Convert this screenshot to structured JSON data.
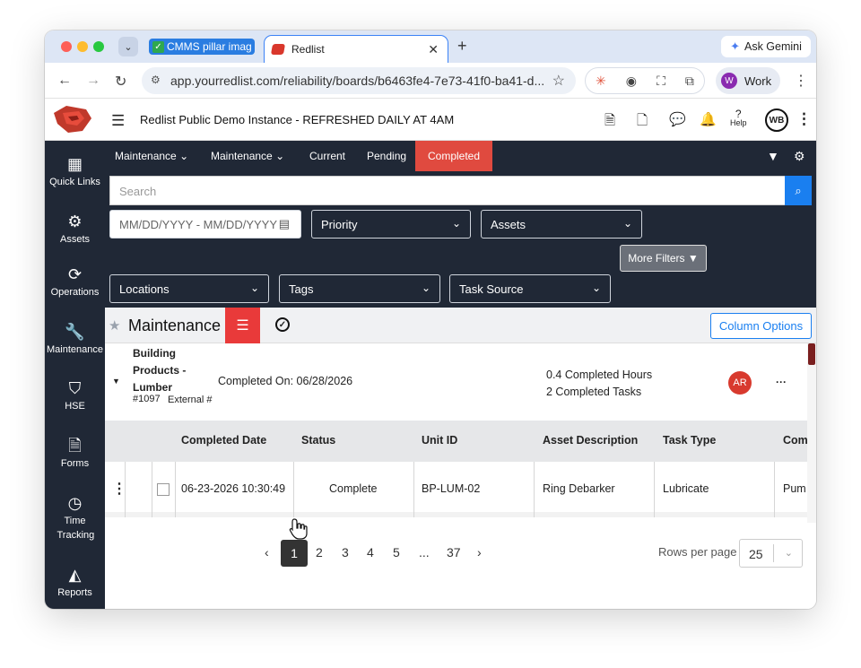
{
  "browser": {
    "tabs": [
      {
        "label": "CMMS pillar imag"
      },
      {
        "label": "Redlist"
      }
    ],
    "ask_gemini": "Ask Gemini",
    "url": "app.yourredlist.com/reliability/boards/b6463fe4-7e73-41f0-ba41-d...",
    "profile": {
      "initial": "W",
      "label": "Work"
    }
  },
  "app_header": {
    "title": "Redlist Public Demo Instance - REFRESHED DAILY AT 4AM",
    "help_label": "Help",
    "user_initials": "WB"
  },
  "sidebar": {
    "items": [
      {
        "label": "Quick Links",
        "icon": "grid-icon"
      },
      {
        "label": "Assets",
        "icon": "gears-icon"
      },
      {
        "label": "Operations",
        "icon": "refresh-icon"
      },
      {
        "label": "Maintenance",
        "icon": "wrench-icon"
      },
      {
        "label": "HSE",
        "icon": "shield-icon"
      },
      {
        "label": "Forms",
        "icon": "document-icon"
      },
      {
        "label": "Time Tracking",
        "icon": "clock-icon"
      },
      {
        "label": "Reports",
        "icon": "chart-icon"
      }
    ]
  },
  "topnav": {
    "items": [
      {
        "label": "Maintenance"
      },
      {
        "label": "Maintenance"
      },
      {
        "label": "Current"
      },
      {
        "label": "Pending"
      },
      {
        "label": "Completed"
      }
    ],
    "active": "Completed",
    "accent": "#e04a3f"
  },
  "filters": {
    "search_placeholder": "Search",
    "date_placeholder": "MM/DD/YYYY - MM/DD/YYYY",
    "priority": "Priority",
    "assets": "Assets",
    "locations": "Locations",
    "tags": "Tags",
    "task_source": "Task Source",
    "more_filters": "More Filters"
  },
  "page": {
    "title": "Maintenance",
    "column_options": "Column Options"
  },
  "group": {
    "name": "Building Products - Lumber",
    "number": "#1097",
    "external_label": "External #",
    "completed_on": "Completed On: 06/28/2026",
    "completed_hours": "0.4 Completed Hours",
    "completed_tasks": "2 Completed Tasks",
    "assignee_initials": "AR"
  },
  "table": {
    "columns": [
      "Completed Date",
      "Status",
      "Unit ID",
      "Asset Description",
      "Task Type",
      "Com"
    ],
    "rows": [
      {
        "completed_date": "06-23-2026 10:30:49",
        "status": "Complete",
        "unit_id": "BP-LUM-02",
        "asset_description": "Ring Debarker",
        "task_type": "Lubricate",
        "com": "Pum"
      }
    ]
  },
  "pagination": {
    "prev": "‹",
    "pages": [
      "1",
      "2",
      "3",
      "4",
      "5",
      "...",
      "37"
    ],
    "next": "›",
    "current": "1",
    "rows_per_page_label": "Rows per page",
    "rows_per_page_value": "25"
  }
}
